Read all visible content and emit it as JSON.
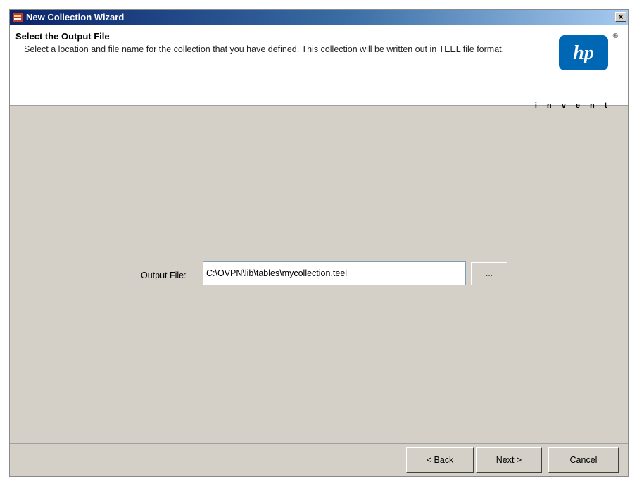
{
  "window": {
    "title": "New Collection Wizard",
    "close_label": "×"
  },
  "header": {
    "title": "Select the Output File",
    "description": "Select a location and file name for the collection that you have defined. This collection will be written out in TEEL file format.",
    "logo_text": "hp",
    "logo_tagline": "i n v e n t",
    "registered_mark": "®"
  },
  "form": {
    "output_label": "Output File:",
    "output_value": "C:\\OVPN\\lib\\tables\\mycollection.teel",
    "browse_label": "..."
  },
  "footer": {
    "back_label": "< Back",
    "next_label": "Next >",
    "cancel_label": "Cancel"
  },
  "colors": {
    "titlebar": "#0a246a",
    "dialog": "#d4d0c8",
    "hp_blue": "#0067b4"
  }
}
